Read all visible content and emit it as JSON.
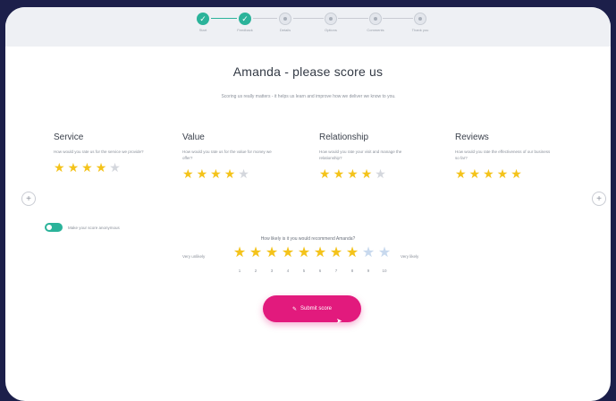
{
  "stepper": {
    "steps": [
      {
        "label": "Start",
        "state": "done"
      },
      {
        "label": "Feedback",
        "state": "done"
      },
      {
        "label": "Details",
        "state": "current"
      },
      {
        "label": "Options",
        "state": "pending"
      },
      {
        "label": "Comments",
        "state": "pending"
      },
      {
        "label": "Thank you",
        "state": "pending"
      }
    ]
  },
  "title": "Amanda - please score us",
  "subtitle": "Scoring us really matters - it helps us learn and improve how we deliver we know to you.",
  "categories": [
    {
      "name": "Service",
      "desc": "How would you rate us for the service we provide?",
      "rating": 4,
      "max": 5
    },
    {
      "name": "Value",
      "desc": "How would you rate us for the value for money we offer?",
      "rating": 4,
      "max": 5
    },
    {
      "name": "Relationship",
      "desc": "How would you rate your visit and manage the relationship?",
      "rating": 4,
      "max": 5
    },
    {
      "name": "Reviews",
      "desc": "How would you rate the effectiveness of our business so far?",
      "rating": 5,
      "max": 5
    }
  ],
  "carousel": {
    "prev_icon": "chevron-left-icon",
    "next_icon": "chevron-right-icon"
  },
  "anonymous_toggle": {
    "label": "Make your score anonymous",
    "on": true
  },
  "nps": {
    "question": "How likely is it you would recommend Amanda?",
    "low_label": "Very unlikely",
    "high_label": "Very likely",
    "numbers": [
      "1",
      "2",
      "3",
      "4",
      "5",
      "6",
      "7",
      "8",
      "9",
      "10"
    ],
    "selected": 8
  },
  "submit_label": "Submit score",
  "colors": {
    "accent": "#2bb39a",
    "star": "#f4c31a",
    "button": "#e21a7d",
    "background": "#1c1f4a"
  }
}
